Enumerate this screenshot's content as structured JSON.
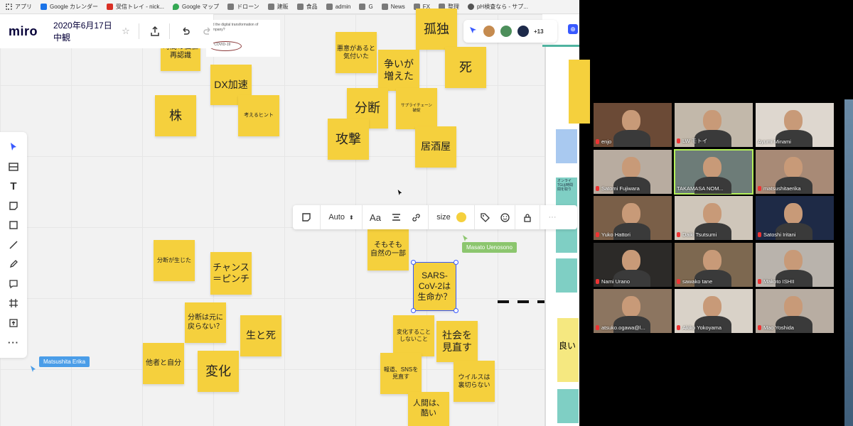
{
  "bookmarks": [
    {
      "label": "アプリ",
      "icon": "apps-grid-icon"
    },
    {
      "label": "Google カレンダー",
      "icon": "calendar-icon"
    },
    {
      "label": "受信トレイ - nick...",
      "icon": "gmail-icon"
    },
    {
      "label": "Google マップ",
      "icon": "maps-pin-icon"
    },
    {
      "label": "ドローン",
      "icon": "folder-icon"
    },
    {
      "label": "建販",
      "icon": "folder-icon"
    },
    {
      "label": "食品",
      "icon": "folder-icon"
    },
    {
      "label": "admin",
      "icon": "folder-icon"
    },
    {
      "label": "G",
      "icon": "folder-icon"
    },
    {
      "label": "News",
      "icon": "folder-icon"
    },
    {
      "label": "FX",
      "icon": "folder-icon"
    },
    {
      "label": "整理",
      "icon": "folder-icon"
    },
    {
      "label": "pH検査なら - サプ...",
      "icon": "globe-icon"
    }
  ],
  "app": {
    "logo": "miro",
    "board_title": "2020年6月17日中観",
    "star": "☆"
  },
  "preview_card": {
    "lines": "ed the digital transformation of\nompany?\n\n\ncf COVID-19"
  },
  "collaborators": {
    "more_count": "+13"
  },
  "context_toolbar": {
    "font_mode": "Auto",
    "font_label": "Aa",
    "size_label": "size",
    "note_color": "#f5d03d",
    "more": "···"
  },
  "stickies": [
    {
      "id": "n1",
      "text": "時間の価値\n再認識"
    },
    {
      "id": "n2",
      "text": "DX加速"
    },
    {
      "id": "n3",
      "text": "株"
    },
    {
      "id": "n4",
      "text": "考えるヒント"
    },
    {
      "id": "n5",
      "text": "悪意があると\n気付いた"
    },
    {
      "id": "n6",
      "text": "孤独"
    },
    {
      "id": "n7",
      "text": "争いが\n増えた"
    },
    {
      "id": "n8",
      "text": "死"
    },
    {
      "id": "n9",
      "text": "分断"
    },
    {
      "id": "n10",
      "text": "サプライチェーン\n破綻"
    },
    {
      "id": "n11",
      "text": "攻撃"
    },
    {
      "id": "n12",
      "text": "居酒屋"
    },
    {
      "id": "n13",
      "text": "そもそも\n自然の一部"
    },
    {
      "id": "n14",
      "text": "SARS-\nCoV-2は\n生命か？"
    },
    {
      "id": "n15",
      "text": "分断が生じた"
    },
    {
      "id": "n16",
      "text": "チャンス\n＝ピンチ"
    },
    {
      "id": "n17",
      "text": "分断は元に\n戻らない？"
    },
    {
      "id": "n18",
      "text": "生と死"
    },
    {
      "id": "n19",
      "text": "他者と自分"
    },
    {
      "id": "n20",
      "text": "変化"
    },
    {
      "id": "n21",
      "text": "変化することしないこと"
    },
    {
      "id": "n22",
      "text": "社会を\n見直す"
    },
    {
      "id": "n23",
      "text": "報道、SNSを\n見直す"
    },
    {
      "id": "n24",
      "text": "ウイルスは\n裏切らない"
    },
    {
      "id": "n25",
      "text": "人間は、\n酷い"
    }
  ],
  "cursors": [
    {
      "name": "Masato Uenosono",
      "color": "#8cc66e"
    },
    {
      "name": "Matsushita Erika",
      "color": "#4a9de8"
    }
  ],
  "side_frame": {
    "notes": [
      "オンライ\nTGは時間\n間を取り",
      "良い"
    ]
  },
  "participants": [
    {
      "name": "enjo",
      "muted": true
    },
    {
      "name": "LW モトイ",
      "muted": true
    },
    {
      "name": "Ayumi Minami",
      "muted": false
    },
    {
      "name": "Satomi Fujiwara",
      "muted": true
    },
    {
      "name": "TAKAMASA NOM...",
      "muted": false,
      "active": true
    },
    {
      "name": "matsushitaerika",
      "muted": true
    },
    {
      "name": "Yuko Hattori",
      "muted": true
    },
    {
      "name": "Daiki Tsutsumi",
      "muted": true
    },
    {
      "name": "Satoshi Iritani",
      "muted": true
    },
    {
      "name": "Nami Urano",
      "muted": true
    },
    {
      "name": "sawako tane",
      "muted": true
    },
    {
      "name": "Makoto ISHII",
      "muted": true
    },
    {
      "name": "atsuko.ogawa@l...",
      "muted": true
    },
    {
      "name": "Akiko Yokoyama",
      "muted": true
    },
    {
      "name": "Mao Yoshida",
      "muted": true
    }
  ]
}
